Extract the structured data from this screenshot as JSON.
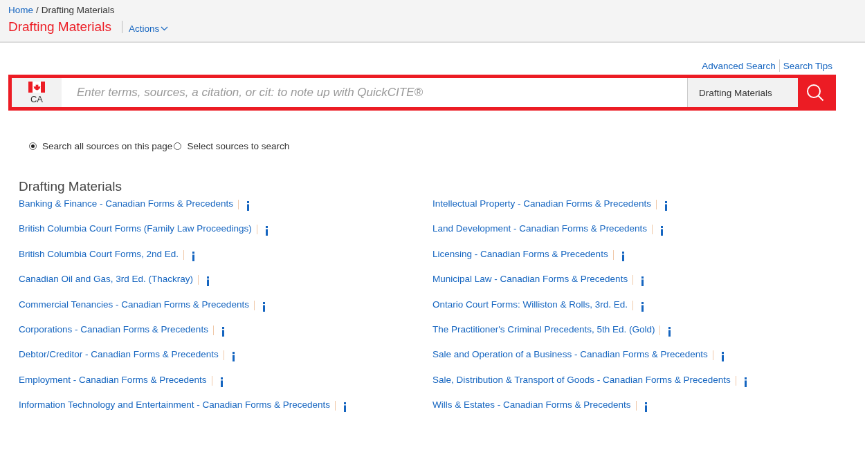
{
  "breadcrumb": {
    "home": "Home",
    "separator": "/",
    "current": "Drafting Materials"
  },
  "page_title": "Drafting Materials",
  "actions_menu": {
    "label": "Actions"
  },
  "search_links": [
    "Advanced Search",
    "Search Tips"
  ],
  "search": {
    "jurisdiction": "CA",
    "placeholder": "Enter terms, sources, a citation, or cit: to note up with QuickCITE®",
    "scope": "Drafting Materials"
  },
  "search_options": [
    {
      "label": "Search all sources on this page",
      "selected": true
    },
    {
      "label": "Select sources to search",
      "selected": false
    }
  ],
  "section_title": "Drafting Materials",
  "sources": [
    {
      "label": "Banking & Finance - Canadian Forms & Precedents"
    },
    {
      "label": "British Columbia Court Forms (Family Law Proceedings)"
    },
    {
      "label": "British Columbia Court Forms, 2nd Ed."
    },
    {
      "label": "Canadian Oil and Gas, 3rd Ed. (Thackray)"
    },
    {
      "label": "Commercial Tenancies - Canadian Forms & Precedents"
    },
    {
      "label": "Corporations - Canadian Forms & Precedents"
    },
    {
      "label": "Debtor/Creditor - Canadian Forms & Precedents"
    },
    {
      "label": "Employment - Canadian Forms & Precedents"
    },
    {
      "label": "Information Technology and Entertainment - Canadian Forms & Precedents"
    },
    {
      "label": "Intellectual Property - Canadian Forms & Precedents"
    },
    {
      "label": "Land Development - Canadian Forms & Precedents"
    },
    {
      "label": "Licensing - Canadian Forms & Precedents"
    },
    {
      "label": "Municipal Law - Canadian Forms & Precedents"
    },
    {
      "label": "Ontario Court Forms: Williston & Rolls, 3rd. Ed."
    },
    {
      "label": "The Practitioner's Criminal Precedents, 5th Ed. (Gold)"
    },
    {
      "label": "Sale and Operation of a Business - Canadian Forms & Precedents"
    },
    {
      "label": "Sale, Distribution & Transport of Goods - Canadian Forms & Precedents"
    },
    {
      "label": "Wills & Estates - Canadian Forms & Precedents"
    }
  ]
}
